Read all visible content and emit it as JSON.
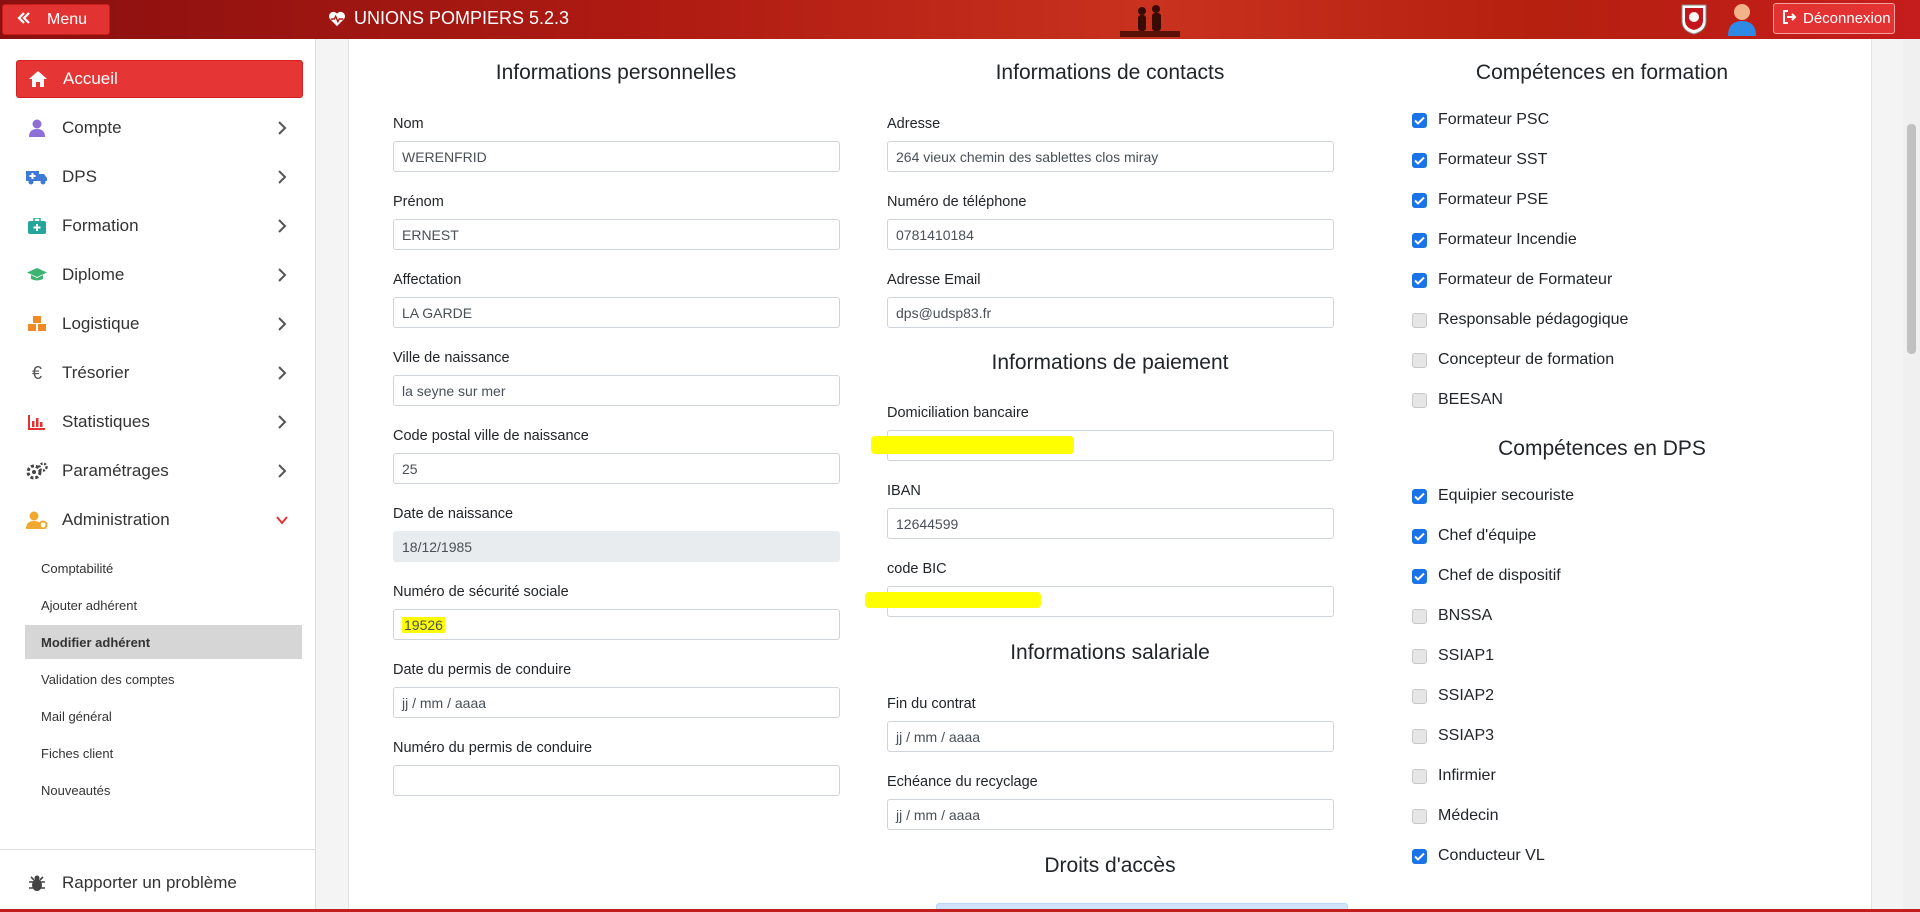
{
  "app": {
    "title": "UNIONS POMPIERS 5.2.3",
    "menu_label": "Menu",
    "logout_label": "Déconnexion"
  },
  "sidebar": {
    "items": [
      {
        "label": "Accueil",
        "icon": "home-icon"
      },
      {
        "label": "Compte",
        "icon": "user-icon"
      },
      {
        "label": "DPS",
        "icon": "ambulance-icon"
      },
      {
        "label": "Formation",
        "icon": "medkit-icon"
      },
      {
        "label": "Diplome",
        "icon": "graduation-cap-icon"
      },
      {
        "label": "Logistique",
        "icon": "boxes-icon"
      },
      {
        "label": "Trésorier",
        "icon": "euro-icon"
      },
      {
        "label": "Statistiques",
        "icon": "chart-icon"
      },
      {
        "label": "Paramétrages",
        "icon": "cogs-icon"
      },
      {
        "label": "Administration",
        "icon": "user-cog-icon"
      }
    ],
    "admin_sub": [
      "Comptabilité",
      "Ajouter adhérent",
      "Modifier adhérent",
      "Validation des comptes",
      "Mail général",
      "Fiches client",
      "Nouveautés"
    ],
    "report_label": "Rapporter un problème"
  },
  "personal": {
    "title": "Informations personnelles",
    "nom_label": "Nom",
    "nom": "WERENFRID",
    "prenom_label": "Prénom",
    "prenom": "ERNEST",
    "affectation_label": "Affectation",
    "affectation": "LA GARDE",
    "ville_label": "Ville de naissance",
    "ville": "la seyne sur mer",
    "cp_label": "Code postal ville de naissance",
    "cp": "25",
    "dob_label": "Date de naissance",
    "dob": "18/12/1985",
    "nss_label": "Numéro de sécurité sociale",
    "nss": "19526",
    "permis_date_label": "Date du permis de conduire",
    "permis_date_placeholder": "jj / mm / aaaa",
    "permis_num_label": "Numéro du permis de conduire",
    "permis_num": ""
  },
  "contacts": {
    "title": "Informations de contacts",
    "adresse_label": "Adresse",
    "adresse": "264 vieux chemin des sablettes clos miray",
    "tel_label": "Numéro de téléphone",
    "tel": "0781410184",
    "email_label": "Adresse Email",
    "email": "dps@udsp83.fr"
  },
  "payment": {
    "title": "Informations de paiement",
    "dom_label": "Domiciliation bancaire",
    "dom": "",
    "iban_label": "IBAN",
    "iban": "12644599",
    "bic_label": "code BIC",
    "bic": ""
  },
  "salary": {
    "title": "Informations salariale",
    "fin_label": "Fin du contrat",
    "fin_placeholder": "jj / mm / aaaa",
    "recyclage_label": "Echéance du recyclage",
    "recyclage_placeholder": "jj / mm / aaaa"
  },
  "access": {
    "title": "Droits d'accès"
  },
  "formation_skills": {
    "title": "Compétences en formation",
    "items": [
      {
        "label": "Formateur PSC",
        "checked": true
      },
      {
        "label": "Formateur SST",
        "checked": true
      },
      {
        "label": "Formateur PSE",
        "checked": true
      },
      {
        "label": "Formateur Incendie",
        "checked": true
      },
      {
        "label": "Formateur de Formateur",
        "checked": true
      },
      {
        "label": "Responsable pédagogique",
        "checked": false
      },
      {
        "label": "Concepteur de formation",
        "checked": false
      },
      {
        "label": "BEESAN",
        "checked": false
      }
    ]
  },
  "dps_skills": {
    "title": "Compétences en DPS",
    "items": [
      {
        "label": "Equipier secouriste",
        "checked": true
      },
      {
        "label": "Chef d'équipe",
        "checked": true
      },
      {
        "label": "Chef de dispositif",
        "checked": true
      },
      {
        "label": "BNSSA",
        "checked": false
      },
      {
        "label": "SSIAP1",
        "checked": false
      },
      {
        "label": "SSIAP2",
        "checked": false
      },
      {
        "label": "SSIAP3",
        "checked": false
      },
      {
        "label": "Infirmier",
        "checked": false
      },
      {
        "label": "Médecin",
        "checked": false
      },
      {
        "label": "Conducteur VL",
        "checked": true
      }
    ]
  },
  "colors": {
    "brand_red": "#e33232",
    "checkbox_blue": "#1a73e8",
    "highlight": "#ffff00"
  }
}
